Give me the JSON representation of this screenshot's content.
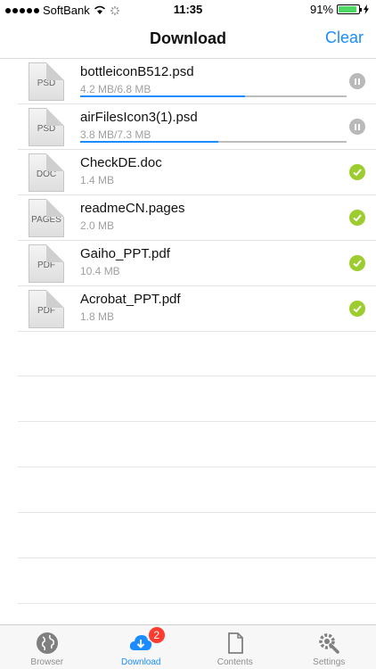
{
  "status": {
    "carrier": "SoftBank",
    "time": "11:35",
    "battery": "91%",
    "battery_level": 0.91
  },
  "nav": {
    "title": "Download",
    "clear": "Clear"
  },
  "files": [
    {
      "type": "PSD",
      "name": "bottleiconB512.psd",
      "size": "4.2 MB/6.8 MB",
      "progress": 0.62,
      "state": "paused"
    },
    {
      "type": "PSD",
      "name": "airFilesIcon3(1).psd",
      "size": "3.8 MB/7.3 MB",
      "progress": 0.52,
      "state": "paused"
    },
    {
      "type": "DOC",
      "name": "CheckDE.doc",
      "size": "1.4 MB",
      "state": "done"
    },
    {
      "type": "PAGES",
      "name": "readmeCN.pages",
      "size": "2.0 MB",
      "state": "done"
    },
    {
      "type": "PDF",
      "name": "Gaiho_PPT.pdf",
      "size": "10.4 MB",
      "state": "done"
    },
    {
      "type": "PDF",
      "name": "Acrobat_PPT.pdf",
      "size": "1.8 MB",
      "state": "done"
    }
  ],
  "tabs": [
    {
      "label": "Browser",
      "icon": "globe-icon",
      "active": false
    },
    {
      "label": "Download",
      "icon": "cloud-download-icon",
      "active": true,
      "badge": "2"
    },
    {
      "label": "Contents",
      "icon": "document-icon",
      "active": false
    },
    {
      "label": "Settings",
      "icon": "gear-wrench-icon",
      "active": false
    }
  ],
  "colors": {
    "accent": "#1a8cff",
    "done": "#9ccc2d",
    "pause": "#b9b9b9",
    "badge": "#ff3b30"
  }
}
